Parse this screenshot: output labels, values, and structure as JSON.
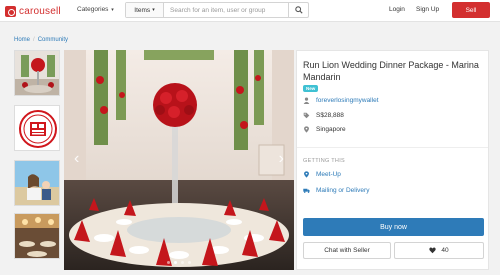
{
  "header": {
    "logo_text": "carousell",
    "categories_label": "Categories",
    "search_type": "Items",
    "search_placeholder": "Search for an item, user or group",
    "login_label": "Login",
    "signup_label": "Sign Up",
    "sell_label": "Sell"
  },
  "breadcrumb": {
    "items": [
      "Home",
      "Community"
    ],
    "separator": "/"
  },
  "listing": {
    "title": "Run Lion Wedding Dinner Package - Marina Mandarin",
    "badge": "New",
    "seller": "foreverlosingmywallet",
    "price": "S$28,888",
    "location": "Singapore"
  },
  "getting_this": {
    "heading": "GETTING THIS",
    "methods": [
      "Meet-Up",
      "Mailing or Delivery"
    ]
  },
  "actions": {
    "buy_label": "Buy now",
    "chat_label": "Chat with Seller",
    "likes": "40"
  },
  "colors": {
    "brand_red": "#d32f2f",
    "link_blue": "#2e7bb8",
    "badge_teal": "#3fc1d3"
  },
  "gallery": {
    "image_count": 4,
    "active_index": 2
  }
}
